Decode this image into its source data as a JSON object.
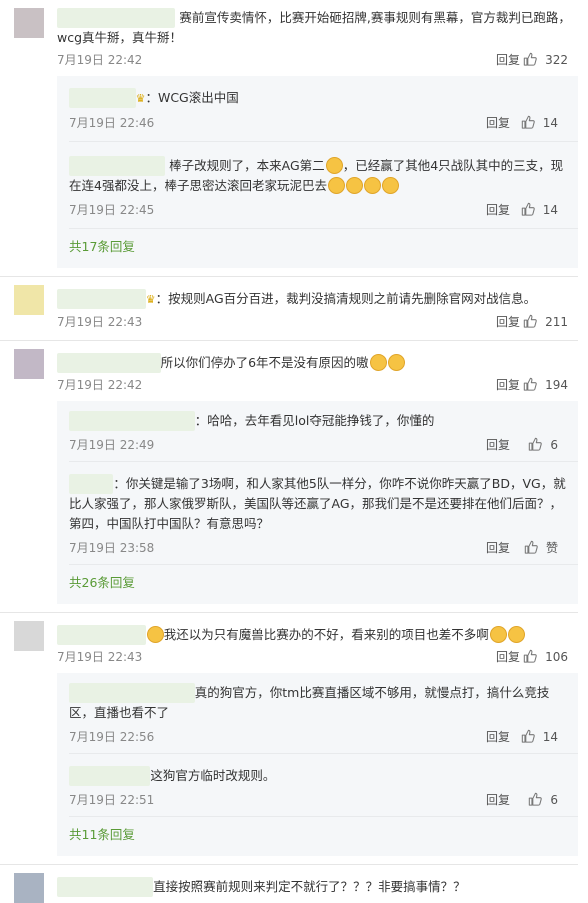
{
  "comments": [
    {
      "text": "赛前宣传卖情怀，比赛开始砸招牌,赛事规则有黑幕，官方裁判已跑路，wcg真牛掰，真牛掰！",
      "date": "7月19日 22:42",
      "reply": "回复",
      "likes": "322",
      "replies": [
        {
          "text": "WCG滚出中国",
          "date": "7月19日 22:46",
          "reply": "回复",
          "likes": "14"
        },
        {
          "text": "棒子改规则了，本来AG第二",
          "text2": "，已经赢了其他4只战队其中的三支，现在连4强都没上，棒子思密达滚回老家玩泥巴去",
          "date": "7月19日 22:45",
          "reply": "回复",
          "likes": "14"
        }
      ],
      "more": "共17条回复"
    },
    {
      "text": "：按规则AG百分百进，裁判没搞清规则之前请先删除官网对战信息。",
      "date": "7月19日 22:43",
      "reply": "回复",
      "likes": "211"
    },
    {
      "text": "所以你们停办了6年不是没有原因的嗷",
      "date": "7月19日 22:42",
      "reply": "回复",
      "likes": "194",
      "replies": [
        {
          "text": "：哈哈，去年看见lol夺冠能挣钱了，你懂的",
          "date": "7月19日 22:49",
          "reply": "回复",
          "likes": "6"
        },
        {
          "text": "：你关键是输了3场啊，和人家其他5队一样分，你咋不说你昨天赢了BD，VG，就比人家强了，那人家俄罗斯队，美国队等还赢了AG，那我们是不是还要排在他们后面？，第四，中国队打中国队？有意思吗？",
          "date": "7月19日 23:58",
          "reply": "回复",
          "likes": "赞"
        }
      ],
      "more": "共26条回复"
    },
    {
      "text": "我还以为只有魔兽比赛办的不好，看来别的项目也差不多啊",
      "date": "7月19日 22:43",
      "reply": "回复",
      "likes": "106",
      "replies": [
        {
          "text": "真的狗官方，你tm比赛直播区域不够用，就慢点打，搞什么竞技区，直播也看不了",
          "date": "7月19日 22:56",
          "reply": "回复",
          "likes": "14"
        },
        {
          "text": "这狗官方临时改规则。",
          "date": "7月19日 22:51",
          "reply": "回复",
          "likes": "6"
        }
      ],
      "more": "共11条回复"
    },
    {
      "text": "直接按照赛前规则来判定不就行了？？？非要搞事情？？"
    }
  ],
  "icons": {
    "thumb": "thumbs-up-icon",
    "emoji": "grin-emoji-icon"
  },
  "colors": {
    "link_green": "#5a9b37",
    "sub_bg": "#f5f7f9"
  }
}
